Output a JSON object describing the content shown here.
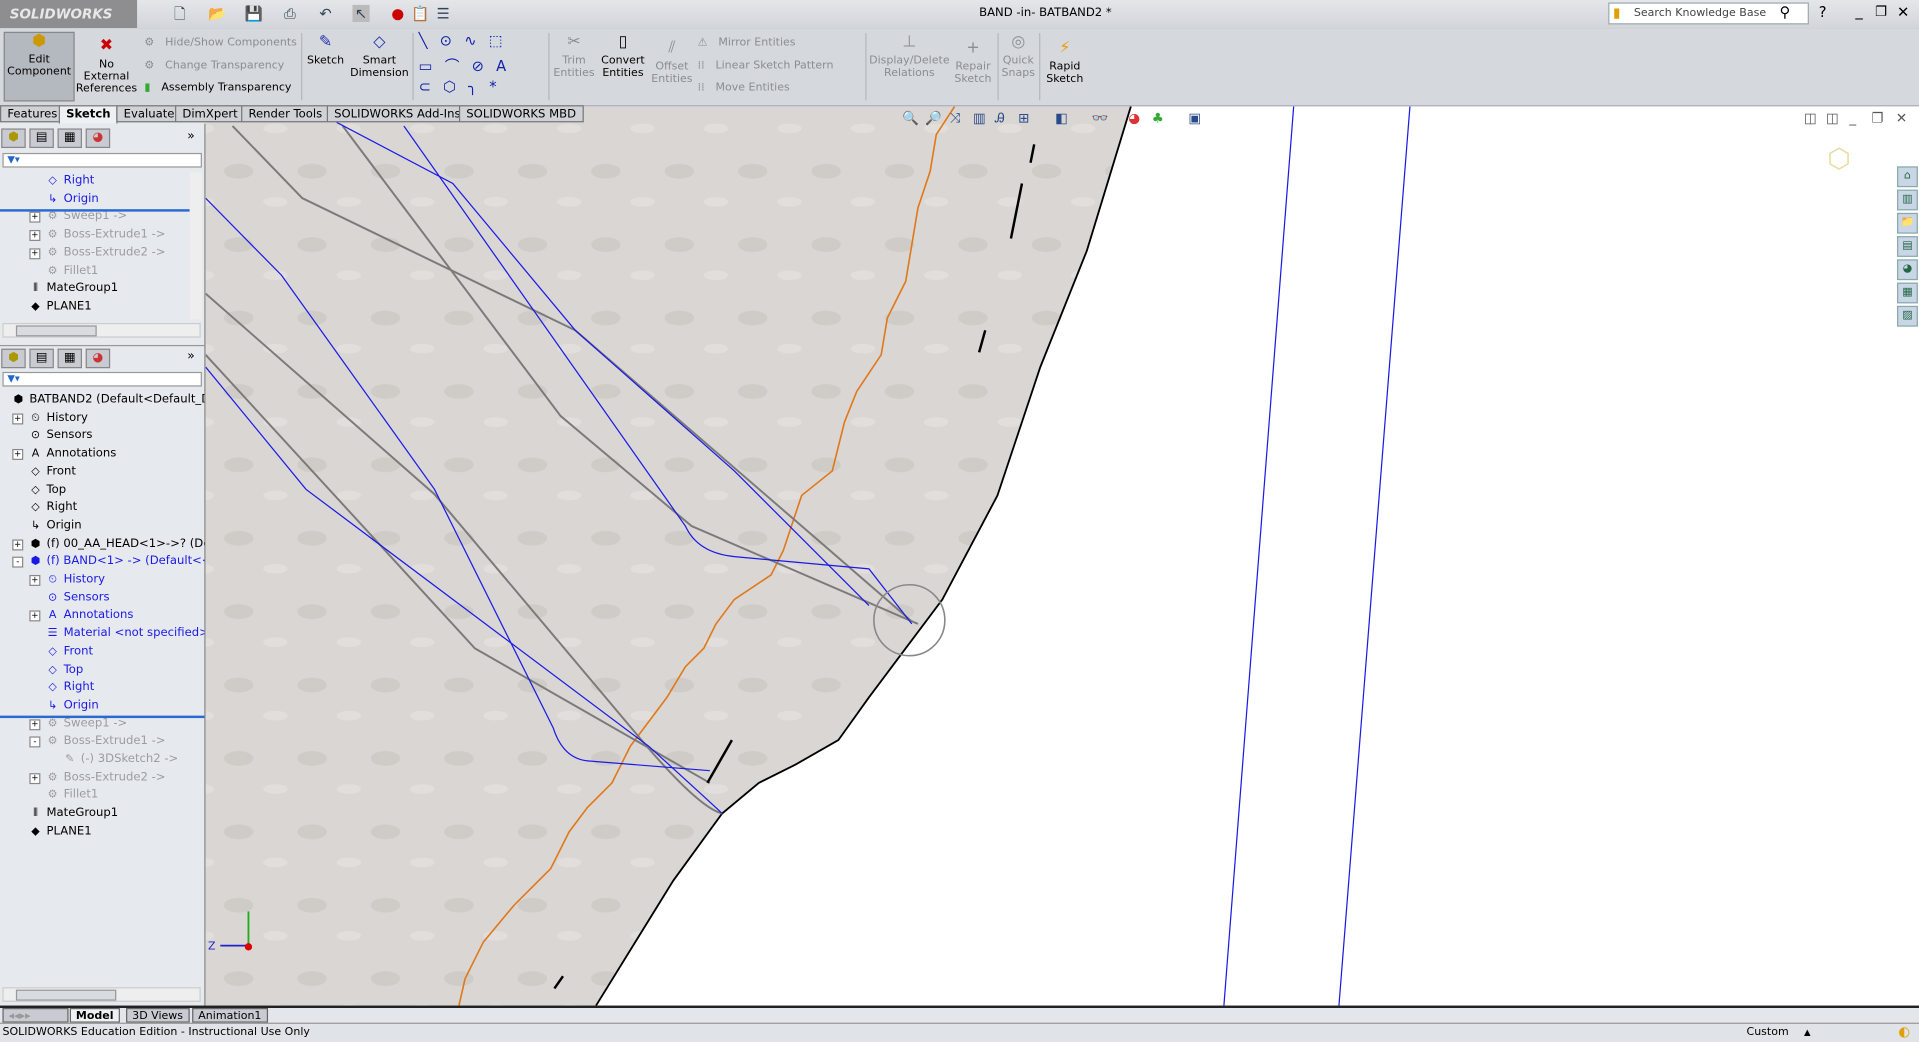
{
  "app": {
    "logo": "SOLIDWORKS",
    "document_title": "BAND -in- BATBAND2 *",
    "search_placeholder": "Search Knowledge Base"
  },
  "ribbon": {
    "edit_component": "Edit Component",
    "no_external_references": "No External References",
    "hide_show_components": "Hide/Show Components",
    "change_transparency": "Change Transparency",
    "assembly_transparency": "Assembly Transparency",
    "sketch": "Sketch",
    "smart_dimension": "Smart Dimension",
    "trim_entities": "Trim Entities",
    "convert_entities": "Convert Entities",
    "offset_entities": "Offset Entities",
    "mirror_entities": "Mirror Entities",
    "linear_sketch_pattern": "Linear Sketch Pattern",
    "move_entities": "Move Entities",
    "display_delete_relations": "Display/Delete Relations",
    "repair_sketch": "Repair Sketch",
    "quick_snaps": "Quick Snaps",
    "rapid_sketch": "Rapid Sketch"
  },
  "tabs": [
    "Features",
    "Sketch",
    "Evaluate",
    "DimXpert",
    "Render Tools",
    "SOLIDWORKS Add-Ins",
    "SOLIDWORKS MBD"
  ],
  "active_tab": "Sketch",
  "top_tree": [
    {
      "label": "Right",
      "style": "blue",
      "indent": 2,
      "icon": "plane"
    },
    {
      "label": "Origin",
      "style": "blue",
      "indent": 2,
      "icon": "origin"
    },
    {
      "label": "Sweep1 ->",
      "style": "gray",
      "indent": 2,
      "icon": "feature",
      "exp": "+"
    },
    {
      "label": "Boss-Extrude1 ->",
      "style": "gray",
      "indent": 2,
      "icon": "feature",
      "exp": "+"
    },
    {
      "label": "Boss-Extrude2 ->",
      "style": "gray",
      "indent": 2,
      "icon": "feature",
      "exp": "+"
    },
    {
      "label": "Fillet1",
      "style": "gray",
      "indent": 2,
      "icon": "feature"
    },
    {
      "label": "MateGroup1",
      "style": "",
      "indent": 1,
      "icon": "mate"
    },
    {
      "label": "PLANE1",
      "style": "",
      "indent": 1,
      "icon": "part"
    }
  ],
  "bottom_tree": [
    {
      "label": "BATBAND2  (Default<Default_D",
      "style": "",
      "indent": 0,
      "icon": "assembly"
    },
    {
      "label": "History",
      "style": "",
      "indent": 1,
      "icon": "history",
      "exp": "+"
    },
    {
      "label": "Sensors",
      "style": "",
      "indent": 1,
      "icon": "sensor"
    },
    {
      "label": "Annotations",
      "style": "",
      "indent": 1,
      "icon": "annotation",
      "exp": "+"
    },
    {
      "label": "Front",
      "style": "",
      "indent": 1,
      "icon": "plane"
    },
    {
      "label": "Top",
      "style": "",
      "indent": 1,
      "icon": "plane"
    },
    {
      "label": "Right",
      "style": "",
      "indent": 1,
      "icon": "plane"
    },
    {
      "label": "Origin",
      "style": "",
      "indent": 1,
      "icon": "origin"
    },
    {
      "label": "(f) 00_AA_HEAD<1>->? (De",
      "style": "",
      "indent": 1,
      "icon": "component",
      "exp": "+"
    },
    {
      "label": "(f) BAND<1> -> (Default<<",
      "style": "blue",
      "indent": 1,
      "icon": "component",
      "exp": "-"
    },
    {
      "label": "History",
      "style": "blue",
      "indent": 2,
      "icon": "history",
      "exp": "+"
    },
    {
      "label": "Sensors",
      "style": "blue",
      "indent": 2,
      "icon": "sensor"
    },
    {
      "label": "Annotations",
      "style": "blue",
      "indent": 2,
      "icon": "annotation",
      "exp": "+"
    },
    {
      "label": "Material <not specified>",
      "style": "blue",
      "indent": 2,
      "icon": "material"
    },
    {
      "label": "Front",
      "style": "blue",
      "indent": 2,
      "icon": "plane"
    },
    {
      "label": "Top",
      "style": "blue",
      "indent": 2,
      "icon": "plane"
    },
    {
      "label": "Right",
      "style": "blue",
      "indent": 2,
      "icon": "plane"
    },
    {
      "label": "Origin",
      "style": "blue",
      "indent": 2,
      "icon": "origin"
    },
    {
      "label": "Sweep1 ->",
      "style": "gray",
      "indent": 2,
      "icon": "feature",
      "exp": "+"
    },
    {
      "label": "Boss-Extrude1 ->",
      "style": "gray",
      "indent": 2,
      "icon": "feature",
      "exp": "-"
    },
    {
      "label": "(-) 3DSketch2 ->",
      "style": "gray",
      "indent": 3,
      "icon": "sketch"
    },
    {
      "label": "Boss-Extrude2 ->",
      "style": "gray",
      "indent": 2,
      "icon": "feature",
      "exp": "+"
    },
    {
      "label": "Fillet1",
      "style": "gray",
      "indent": 2,
      "icon": "feature"
    },
    {
      "label": "MateGroup1",
      "style": "",
      "indent": 1,
      "icon": "mate"
    },
    {
      "label": "PLANE1",
      "style": "",
      "indent": 1,
      "icon": "part"
    }
  ],
  "bottom_tabs": [
    "Model",
    "3D Views",
    "Animation1"
  ],
  "status": {
    "message": "SOLIDWORKS Education Edition - Instructional Use Only",
    "units": "Custom"
  },
  "triad": {
    "z_label": "Z"
  },
  "colors": {
    "sketch_blue": "#1a1ae6",
    "path_orange": "#e07818",
    "edge_black": "#000000",
    "sketch_gray": "#7a7a7a"
  }
}
